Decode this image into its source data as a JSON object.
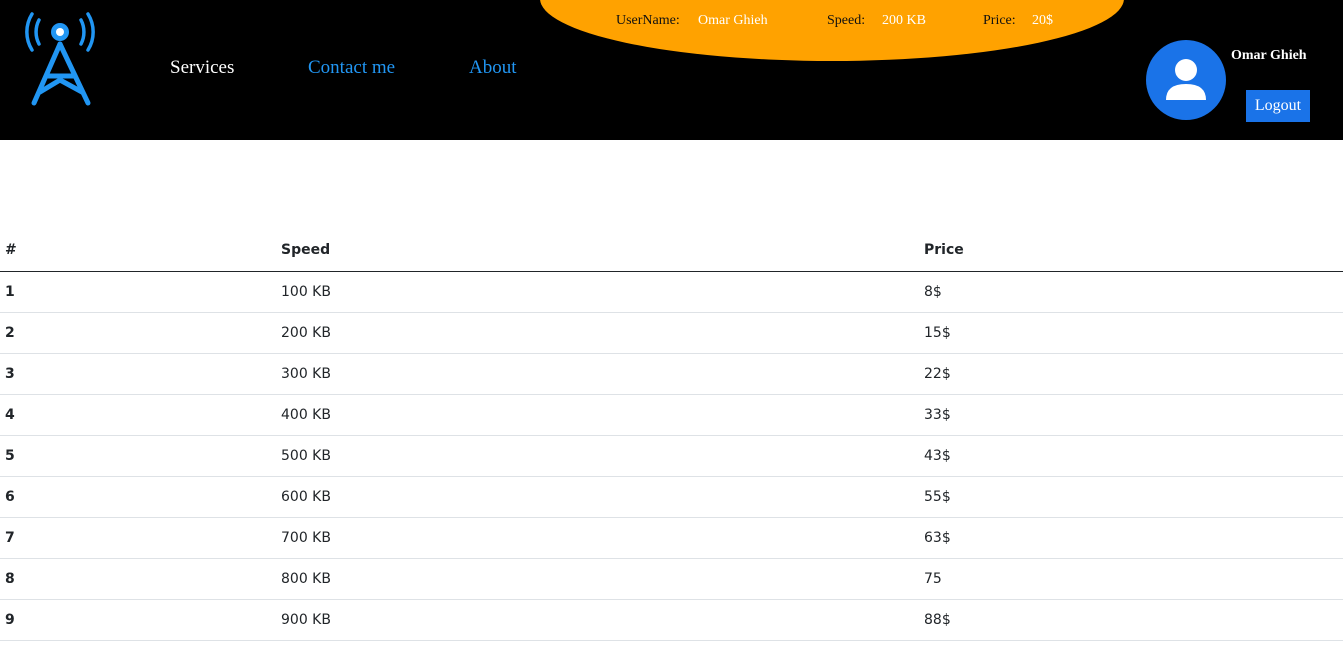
{
  "colors": {
    "header_bg": "#000000",
    "accent_blue": "#2196f3",
    "info_bg": "#ffa200",
    "button_blue": "#1a73e8"
  },
  "header": {
    "logo_icon": "radio-tower-icon",
    "nav": {
      "services": "Services",
      "contact": "Contact me",
      "about": "About"
    },
    "info": {
      "username_label": "UserName:",
      "username_value": "Omar Ghieh",
      "speed_label": "Speed:",
      "speed_value": "200 KB",
      "price_label": "Price:",
      "price_value": "20$"
    },
    "profile": {
      "avatar_icon": "user-avatar-icon",
      "name": "Omar Ghieh",
      "logout_label": "Logout"
    }
  },
  "table": {
    "headers": [
      "#",
      "Speed",
      "Price"
    ],
    "rows": [
      [
        "1",
        "100 KB",
        "8$"
      ],
      [
        "2",
        "200 KB",
        "15$"
      ],
      [
        "3",
        "300 KB",
        "22$"
      ],
      [
        "4",
        "400 KB",
        "33$"
      ],
      [
        "5",
        "500 KB",
        "43$"
      ],
      [
        "6",
        "600 KB",
        "55$"
      ],
      [
        "7",
        "700 KB",
        "63$"
      ],
      [
        "8",
        "800 KB",
        "75"
      ],
      [
        "9",
        "900 KB",
        "88$"
      ]
    ]
  }
}
